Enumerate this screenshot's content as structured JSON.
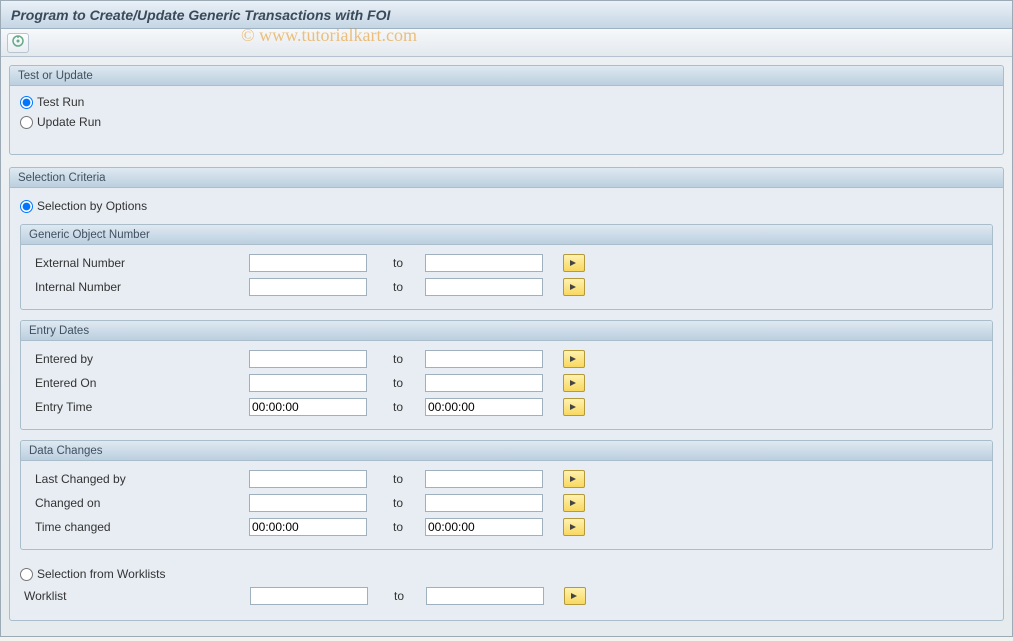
{
  "title": "Program to Create/Update Generic Transactions with FOI",
  "watermark": "© www.tutorialkart.com",
  "toolbar": {
    "execute_icon": "execute"
  },
  "groups": {
    "test_update": {
      "title": "Test or Update",
      "options": [
        {
          "label": "Test Run",
          "checked": true
        },
        {
          "label": "Update Run",
          "checked": false
        }
      ]
    },
    "selection_criteria": {
      "title": "Selection Criteria",
      "by_options": {
        "label": "Selection by Options",
        "checked": true
      },
      "from_worklists": {
        "label": "Selection from Worklists",
        "checked": false
      },
      "worklist": {
        "label": "Worklist",
        "from": "",
        "to": ""
      }
    },
    "generic_object_number": {
      "title": "Generic Object Number",
      "rows": [
        {
          "label": "External Number",
          "from": "",
          "to": ""
        },
        {
          "label": "Internal Number",
          "from": "",
          "to": ""
        }
      ]
    },
    "entry_dates": {
      "title": "Entry Dates",
      "rows": [
        {
          "label": "Entered by",
          "from": "",
          "to": ""
        },
        {
          "label": "Entered On",
          "from": "",
          "to": ""
        },
        {
          "label": "Entry Time",
          "from": "00:00:00",
          "to": "00:00:00"
        }
      ]
    },
    "data_changes": {
      "title": "Data Changes",
      "rows": [
        {
          "label": "Last Changed by",
          "from": "",
          "to": ""
        },
        {
          "label": "Changed on",
          "from": "",
          "to": ""
        },
        {
          "label": "Time changed",
          "from": "00:00:00",
          "to": "00:00:00"
        }
      ]
    }
  },
  "common": {
    "to": "to"
  }
}
